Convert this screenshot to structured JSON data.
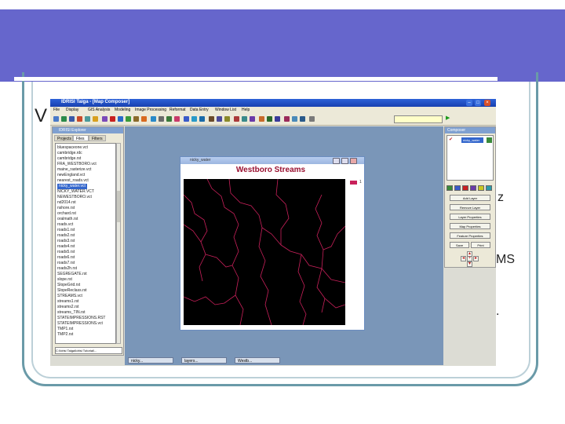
{
  "slide": {
    "fragments": {
      "left_v": "V",
      "right_z": "z",
      "right_ms": "MS",
      "right_dot": "."
    }
  },
  "app": {
    "title": "IDRISI Taiga - [Map Composer]",
    "menu": [
      "File",
      "Display",
      "GIS Analysis",
      "Modeling",
      "Image Processing",
      "Reformat",
      "Data Entry",
      "Window List",
      "Help"
    ],
    "explorer": {
      "title": "IDRISI Explorer",
      "tabs": [
        "Projects",
        "Files",
        "Filters"
      ],
      "active_tab": "Files",
      "files": [
        "bluespaceone.vct",
        "cambridge.rdc",
        "cambridge.rst",
        "FRA_WESTBORO.vct",
        "maine_rasterize.vct",
        "newEngland.vct",
        "nearest_roads.vct",
        "nicky_water.vct",
        "NICKY_WATER.VCT",
        "NEWESTBORO.vct",
        "nd2014.rst",
        "nshore.rst",
        "orchard.rst",
        "oralmath.rst",
        "roads.vct",
        "roads1.rst",
        "roads2.rst",
        "roads3.rst",
        "roads4.rst",
        "roads5.rst",
        "roads6.rst",
        "roads7.rst",
        "roads2h.rst",
        "SEGREGATE.rst",
        "slope.rst",
        "SlopeGrid.rst",
        "SlopeReclass.rst",
        "STREAMS.vct",
        "streams1.rst",
        "streams2.rst",
        "streams_TIN.rst",
        "STATEIMPRESSIONS.RST",
        "STATEIMPRESSIONS.vct",
        "TMP1.rst",
        "TMP2.rst"
      ],
      "selected_file": "nicky_water.vct",
      "path_field": "C:\\Idrisi Taiga\\Idrisi Tutorial\\..."
    },
    "map_window": {
      "caption": "nicky_water",
      "map_title": "Westboro Streams",
      "legend_label": "1"
    },
    "taskbar_items": [
      "nicky...",
      "layers...",
      "Westb..."
    ],
    "composer": {
      "title": "Composer",
      "layer_name": "nicky_water",
      "buttons": [
        "Add Layer",
        "Remove Layer",
        "Layer Properties",
        "Map Properties",
        "Feature Properties"
      ],
      "save_label": "Save",
      "print_label": "Print"
    }
  },
  "colors": {
    "banner": "#6666cc",
    "streams": "#c8205a",
    "selection": "#3366cc"
  }
}
